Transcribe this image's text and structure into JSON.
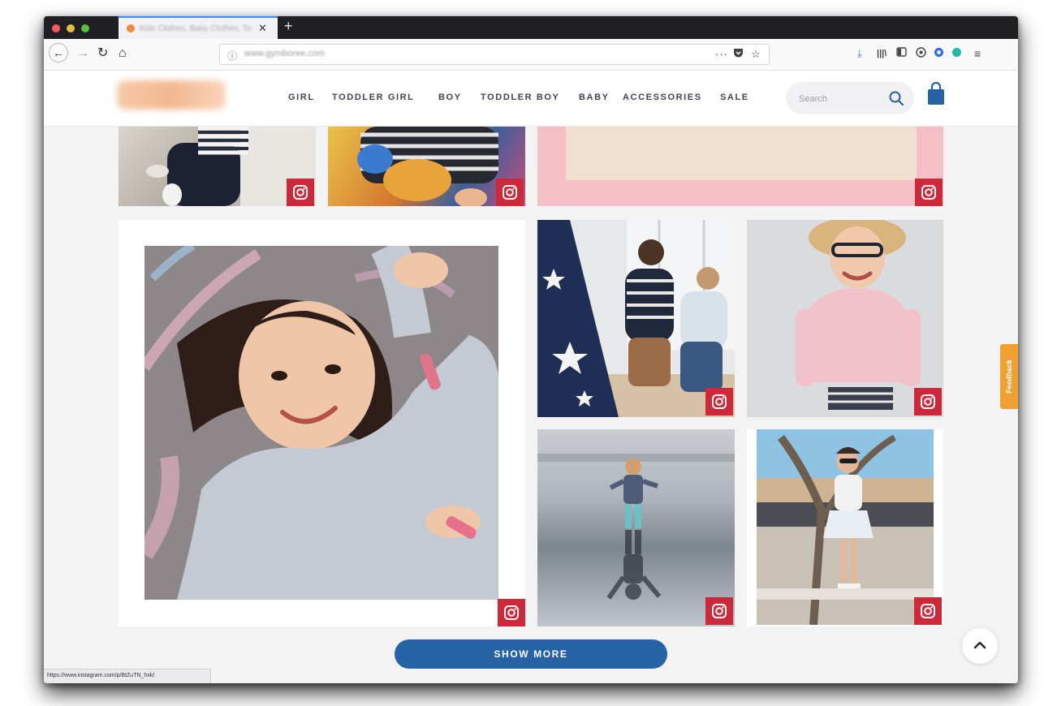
{
  "browser": {
    "tab_title": "Kids Clothes, Baby Clothes, Toddler Clothes",
    "tab_close": "✕",
    "new_tab": "+",
    "url": "www.gymboree.com",
    "status_url": "https://www.instagram.com/p/BtZuTN_hxk/"
  },
  "site": {
    "nav": [
      {
        "label": "GIRL"
      },
      {
        "label": "TODDLER GIRL"
      },
      {
        "label": "BOY"
      },
      {
        "label": "TODDLER BOY"
      },
      {
        "label": "BABY"
      },
      {
        "label": "ACCESSORIES"
      },
      {
        "label": "SALE"
      }
    ],
    "search_placeholder": "Search"
  },
  "gallery": {
    "show_more_label": "SHOW MORE",
    "feedback_label": "Feedback",
    "icons": {
      "badge": "instagram-icon",
      "scroll": "chevron-up-icon",
      "cart": "shopping-bag-icon"
    }
  },
  "colors": {
    "accent_blue": "#2761a6",
    "instagram_red": "#cc2a3b",
    "feedback_orange": "#f0a030",
    "nav_text": "#404552"
  }
}
